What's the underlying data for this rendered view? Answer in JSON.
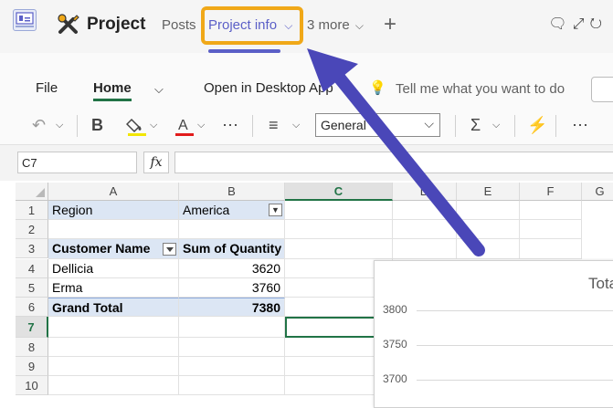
{
  "header": {
    "team_name": "Project",
    "tabs": [
      {
        "label": "Posts"
      },
      {
        "label": "Project info"
      },
      {
        "label": "3 more"
      }
    ],
    "add_tab": "+"
  },
  "ribbon": {
    "tabs": [
      "File",
      "Home"
    ],
    "open_desktop": "Open in Desktop App",
    "tell_me": "Tell me what you want to do",
    "number_format": "General"
  },
  "formula_bar": {
    "name_box": "C7",
    "fx": "fx",
    "formula": ""
  },
  "grid": {
    "columns": [
      "A",
      "B",
      "C",
      "D",
      "E",
      "F",
      "G"
    ],
    "selected_column": "C",
    "rows": [
      "1",
      "2",
      "3",
      "4",
      "5",
      "6",
      "7",
      "8",
      "9",
      "10"
    ],
    "selected_row": "7",
    "cells": {
      "A1": "Region",
      "B1": "America",
      "A3": "Customer Name",
      "B3": "Sum of Quantity",
      "A4": "Dellicia",
      "B4": "3620",
      "A5": "Erma",
      "B5": "3760",
      "A6": "Grand Total",
      "B6": "7380"
    }
  },
  "chart_data": {
    "type": "bar",
    "title": "Tota",
    "y_ticks": [
      "3800",
      "3750",
      "3700"
    ],
    "ylim": [
      3700,
      3800
    ]
  },
  "colors": {
    "accent": "#5b5fc7",
    "highlight": "#f0a818",
    "excel_green": "#217346",
    "pivot_blue": "#dce6f4",
    "annotation_arrow": "#4a47b8"
  }
}
